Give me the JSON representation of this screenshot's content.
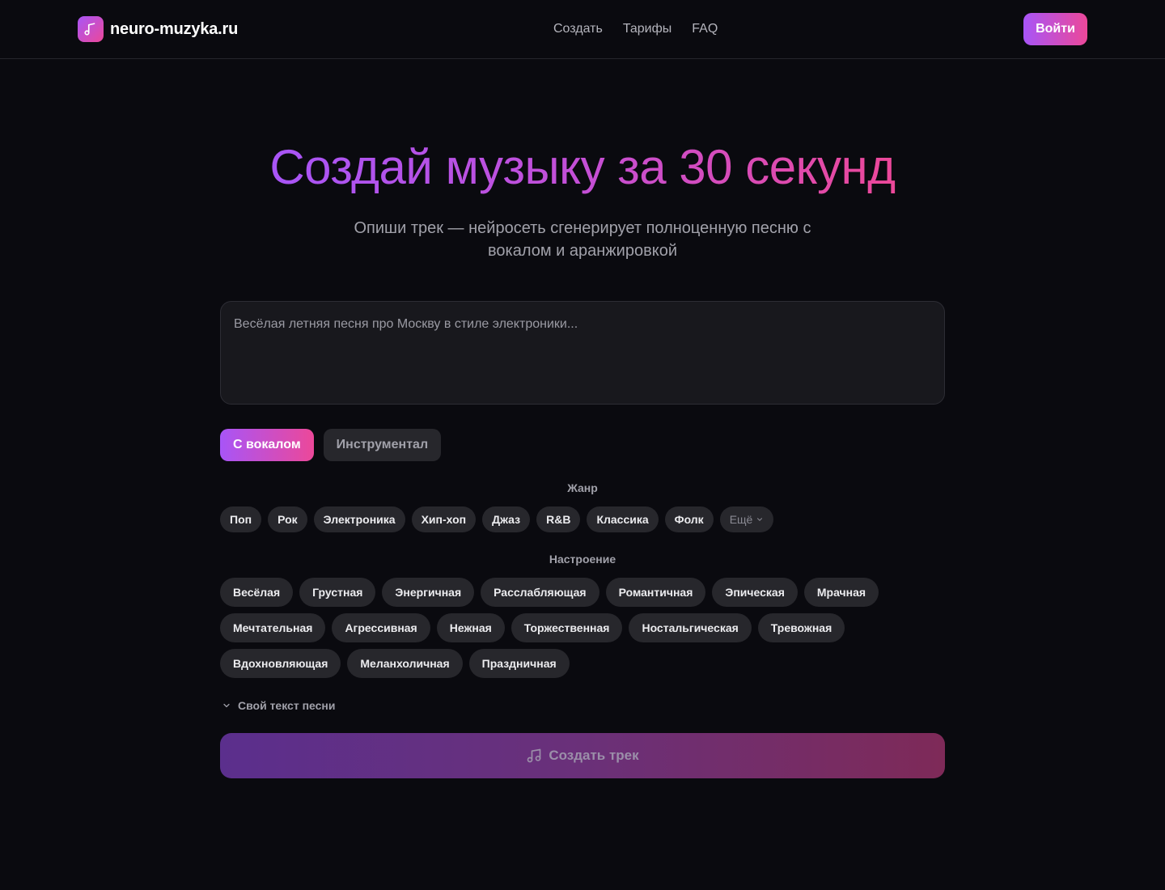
{
  "header": {
    "logo_text": "neuro-muzyka.ru",
    "nav": [
      "Создать",
      "Тарифы",
      "FAQ"
    ],
    "login_label": "Войти"
  },
  "hero": {
    "title": "Создай музыку за 30 секунд",
    "subtitle": "Опиши трек — нейросеть сгенерирует полноценную песню с вокалом и аранжировкой"
  },
  "prompt": {
    "value": "",
    "placeholder": "Весёлая летняя песня про Москву в стиле электроники..."
  },
  "mode": {
    "vocal_label": "С вокалом",
    "instrumental_label": "Инструментал",
    "selected": "vocal"
  },
  "genre": {
    "label": "Жанр",
    "items": [
      "Поп",
      "Рок",
      "Электроника",
      "Хип-хоп",
      "Джаз",
      "R&B",
      "Классика",
      "Фолк"
    ],
    "more_label": "Ещё"
  },
  "mood": {
    "label": "Настроение",
    "items": [
      "Весёлая",
      "Грустная",
      "Энергичная",
      "Расслабляющая",
      "Романтичная",
      "Эпическая",
      "Мрачная",
      "Мечтательная",
      "Агрессивная",
      "Нежная",
      "Торжественная",
      "Ностальгическая",
      "Тревожная",
      "Вдохновляющая",
      "Меланхоличная",
      "Праздничная"
    ]
  },
  "lyrics_toggle_label": "Свой текст песни",
  "create_label": "Создать трек",
  "colors": {
    "background": "#0a0a0f",
    "accent_start": "#a855f7",
    "accent_end": "#ec4899",
    "chip": "#27272c"
  }
}
